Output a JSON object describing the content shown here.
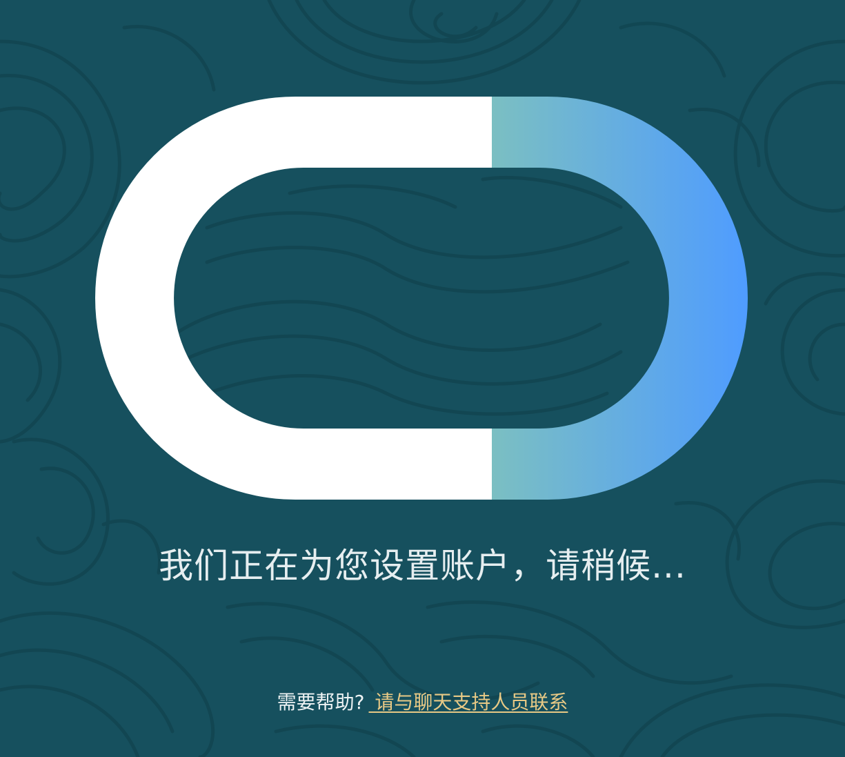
{
  "colors": {
    "background": "#16505e",
    "pattern_line": "#0f3f4a",
    "logo_white": "#ffffff",
    "logo_gradient_start": "#7bbfc2",
    "logo_gradient_end": "#4f9cff",
    "status_text": "#e6eef0",
    "link": "#e8c985"
  },
  "status": {
    "message": "我们正在为您设置账户，请稍候..."
  },
  "help": {
    "prompt": "需要帮助?",
    "link_label": " 请与聊天支持人员联系"
  }
}
